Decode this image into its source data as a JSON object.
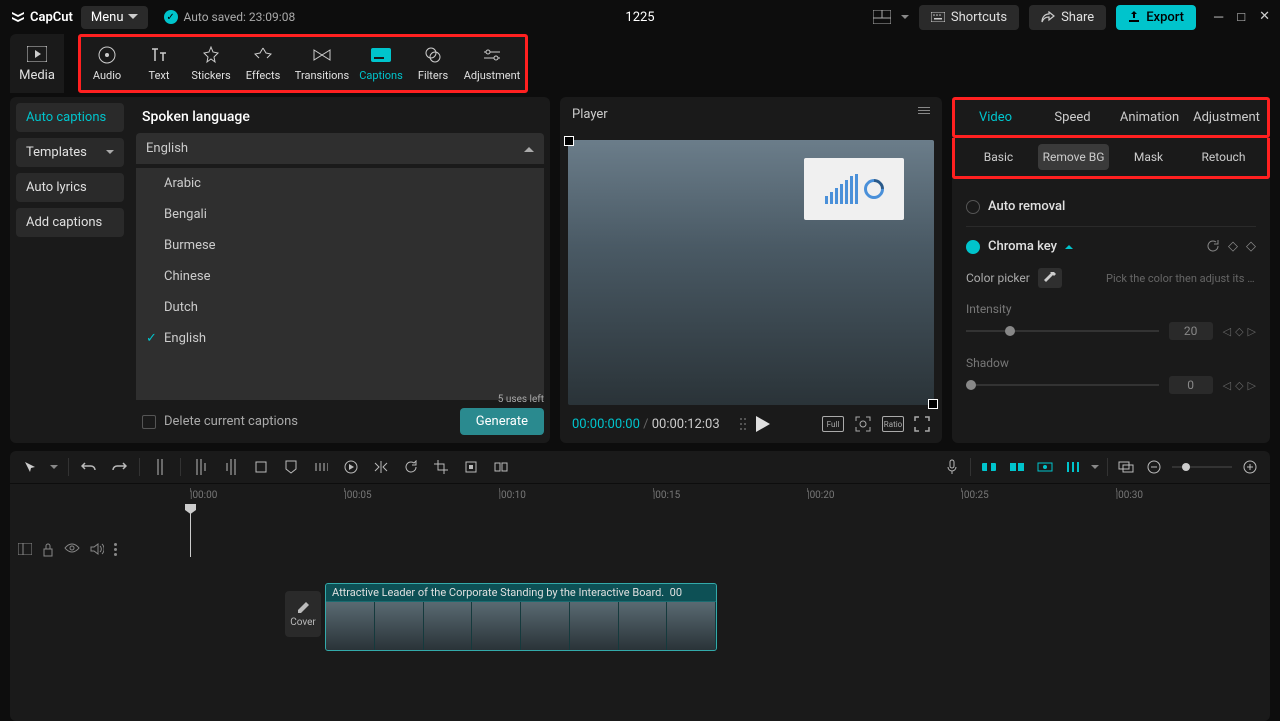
{
  "app": {
    "name": "CapCut",
    "menu": "Menu",
    "autosaved": "Auto saved: 23:09:08",
    "project": "1225"
  },
  "top": {
    "shortcuts": "Shortcuts",
    "share": "Share",
    "export": "Export"
  },
  "cats": {
    "media": "Media",
    "audio": "Audio",
    "text": "Text",
    "stickers": "Stickers",
    "effects": "Effects",
    "transitions": "Transitions",
    "captions": "Captions",
    "filters": "Filters",
    "adjustment": "Adjustment"
  },
  "sidebar": {
    "auto_captions": "Auto captions",
    "templates": "Templates",
    "auto_lyrics": "Auto lyrics",
    "add_captions": "Add captions"
  },
  "lang": {
    "label": "Spoken language",
    "selected": "English",
    "options": [
      "Arabic",
      "Bengali",
      "Burmese",
      "Chinese",
      "Dutch",
      "English"
    ],
    "delete": "Delete current captions",
    "uses": "5 uses left",
    "generate": "Generate"
  },
  "player": {
    "title": "Player",
    "current": "00:00:00:00",
    "duration": "00:00:12:03",
    "full": "Full",
    "ratio": "Ratio"
  },
  "props": {
    "tabs": {
      "video": "Video",
      "speed": "Speed",
      "animation": "Animation",
      "adjustment": "Adjustment"
    },
    "subtabs": {
      "basic": "Basic",
      "remove_bg": "Remove BG",
      "mask": "Mask",
      "retouch": "Retouch"
    },
    "auto_removal": "Auto removal",
    "chroma": "Chroma key",
    "color_picker": "Color picker",
    "picker_hint": "Pick the color then adjust its in...",
    "intensity": "Intensity",
    "intensity_val": "20",
    "shadow": "Shadow",
    "shadow_val": "0"
  },
  "timeline": {
    "marks": [
      "|00:00",
      "|00:05",
      "|00:10",
      "|00:15",
      "|00:20",
      "|00:25",
      "|00:30"
    ],
    "cover": "Cover",
    "clip_label": "Attractive Leader of the Corporate Standing by the Interactive Board.",
    "clip_tail": "00"
  }
}
